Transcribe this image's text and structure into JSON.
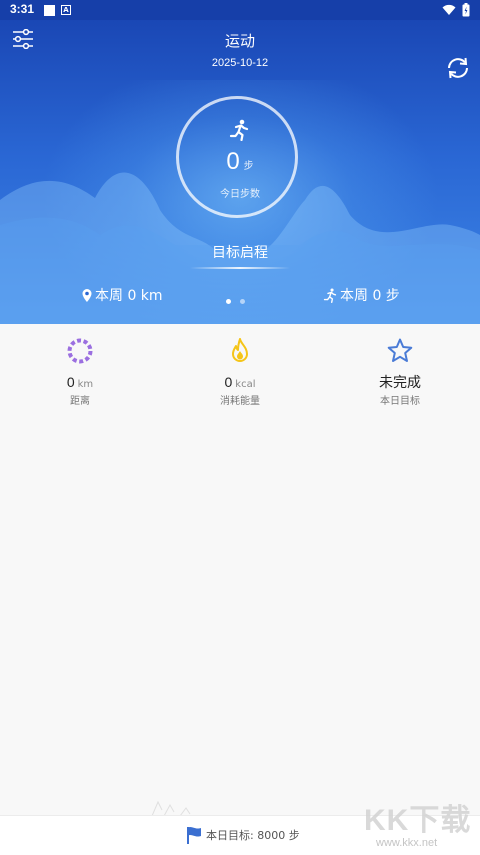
{
  "status_bar": {
    "time": "3:31",
    "notification_icon": "A"
  },
  "header": {
    "title": "运动",
    "date": "2025-10-12",
    "steps_value": "0",
    "steps_unit": "步",
    "steps_label": "今日步数",
    "goal_label": "目标启程",
    "week_distance": "本周 0 km",
    "week_steps": "本周 0 步",
    "pager": {
      "pages": 2,
      "active": 0
    }
  },
  "stats": [
    {
      "icon": "distance-ring-icon",
      "value": "0",
      "unit": "km",
      "label": "距离",
      "color": "#9b6fe0"
    },
    {
      "icon": "flame-icon",
      "value": "0",
      "unit": "kcal",
      "label": "消耗能量",
      "color": "#f5c518"
    },
    {
      "icon": "star-icon",
      "value": "未完成",
      "unit": "",
      "label": "本日目标",
      "color": "#4a7bd6"
    }
  ],
  "footer": {
    "goal_text": "本日目标: 8000 步"
  },
  "watermark": {
    "brand": "KK下载",
    "url": "www.kkx.net"
  },
  "colors": {
    "header_top": "#1a47b5",
    "header_bottom": "#3e87e7",
    "accent": "#4a7bd6"
  }
}
